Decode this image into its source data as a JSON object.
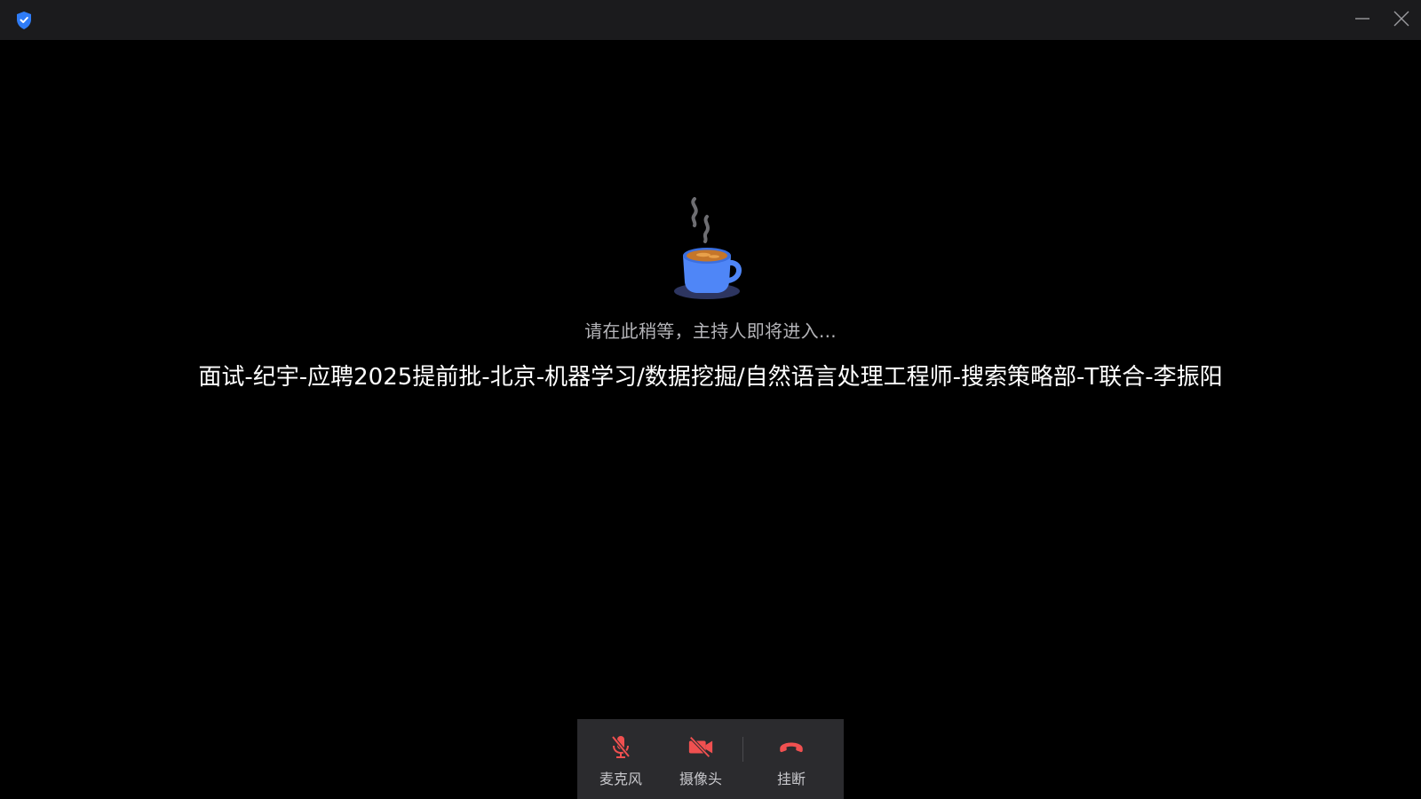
{
  "titlebar": {
    "logo_icon": "shield-check-icon",
    "minimize_icon": "minimize-icon",
    "close_icon": "close-icon"
  },
  "waiting": {
    "illustration_icon": "coffee-cup-icon",
    "message": "请在此稍等，主持人即将进入...",
    "meeting_title": "面试-纪宇-应聘2025提前批-北京-机器学习/数据挖掘/自然语言处理工程师-搜索策略部-T联合-李振阳"
  },
  "toolbar": {
    "mic": {
      "label": "麦克风",
      "icon": "mic-muted-icon",
      "state": "muted"
    },
    "camera": {
      "label": "摄像头",
      "icon": "camera-off-icon",
      "state": "off"
    },
    "hangup": {
      "label": "挂断",
      "icon": "hang-up-icon"
    }
  },
  "colors": {
    "background": "#000000",
    "titlebar": "#1b1b1d",
    "toolbar": "#2b2b2e",
    "muted_red": "#f05050",
    "logo_blue": "#2f7cf6",
    "cup_blue": "#4f86f7"
  }
}
